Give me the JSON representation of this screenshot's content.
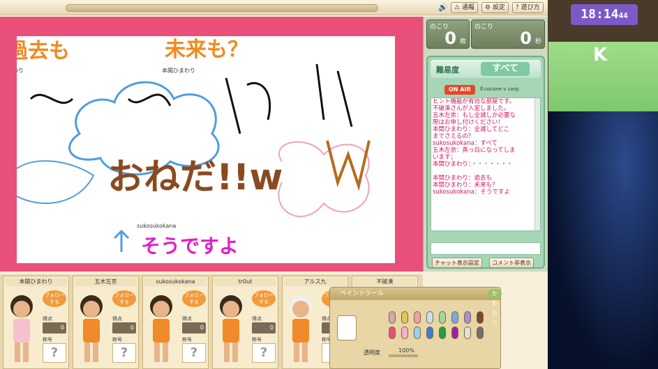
{
  "toolbar": {
    "buttons": [
      {
        "label": "通報",
        "icon": "alert-icon"
      },
      {
        "label": "設定",
        "icon": "gear-icon"
      },
      {
        "label": "遊び方",
        "icon": "help-icon"
      }
    ]
  },
  "counters": {
    "cards": {
      "label": "のこり",
      "value": "0",
      "unit": "枚"
    },
    "seconds": {
      "label": "のこり",
      "value": "0",
      "unit": "秒"
    }
  },
  "canvas": {
    "drawing_text": {
      "top_left": "過去も",
      "top_middle": "未来も？",
      "bottom_pink": "そうですよ",
      "big_brown": "おねだ!!w"
    },
    "name_tags": [
      "ひまわり",
      "本間ひまわり",
      "sukosukokana"
    ]
  },
  "chat": {
    "difficulty_label": "難易度",
    "difficulty_value": "すべて",
    "onair": "ON AIR",
    "copyright": "©cocone v corp.",
    "messages": [
      {
        "text": "ヒント機能が有効な部屋です。",
        "color": "#d4145a"
      },
      {
        "text": "不破湊さんが入室しました。",
        "color": "#d4145a"
      },
      {
        "text": "五木左京：もし全滅しか必要な",
        "color": "#d4145a"
      },
      {
        "text": "際はお申し付けください！",
        "color": "#d4145a"
      },
      {
        "text": "本間ひまわり：全滅してどこ",
        "color": "#d4145a"
      },
      {
        "text": "までさえるの？",
        "color": "#d4145a"
      },
      {
        "text": "sukosukokana：すべて",
        "color": "#d4145a"
      },
      {
        "text": "五木左京：真っ白になってしま",
        "color": "#d4145a"
      },
      {
        "text": "います；",
        "color": "#d4145a"
      },
      {
        "text": "本間ひまわり：・・・・・・・",
        "color": "#d4145a"
      },
      {
        "text": "",
        "color": "#333"
      },
      {
        "text": "本間ひまわり：過去も",
        "color": "#d4145a"
      },
      {
        "text": "本間ひまわり：未来も？",
        "color": "#d4145a"
      },
      {
        "text": "sukosukokana：そうですよ",
        "color": "#d4145a"
      }
    ],
    "buttons": [
      "チャット表示設定",
      "コメント非表示"
    ]
  },
  "players": [
    {
      "name": "本間ひまわり",
      "follow": "フォローする",
      "score_label": "得点",
      "title_label": "称号",
      "title_value": "?",
      "score": "0"
    },
    {
      "name": "五木左京",
      "follow": "フォローする",
      "score_label": "得点",
      "title_label": "称号",
      "title_value": "?",
      "score": "0"
    },
    {
      "name": "sukosukokana",
      "follow": "フォローする",
      "score_label": "得点",
      "title_label": "称号",
      "title_value": "?",
      "score": "0"
    },
    {
      "name": "tr0ut",
      "follow": "フォローする",
      "score_label": "得点",
      "title_label": "称号",
      "title_value": "?",
      "score": "0"
    },
    {
      "name": "アルス九",
      "follow": "フォローする",
      "score_label": "得点",
      "title_label": "称号",
      "title_value": "?",
      "score": "0"
    },
    {
      "name": "不破湊",
      "follow": "",
      "score_label": "",
      "title_label": "",
      "title_value": "",
      "score": ""
    }
  ],
  "paint": {
    "title": "ペイントツール",
    "kaomoji": "かおもじ",
    "opacity_label": "透明度",
    "opacity_value": "100%",
    "colors": [
      "#d4a8a8",
      "#e6c35a",
      "#f0a0a0",
      "#c8e0f0",
      "#9fd89f",
      "#7fa6e0",
      "#b08ad6",
      "#7b4a2a",
      "#e8507a",
      "#f7b0c8",
      "#a0d0e8",
      "#3a7fd0",
      "#20a040",
      "#a020a0",
      "#e0e0e0",
      "#707070"
    ]
  },
  "overlay": {
    "clock": "18:14",
    "clock_seconds": "44",
    "group_letter": "K"
  }
}
